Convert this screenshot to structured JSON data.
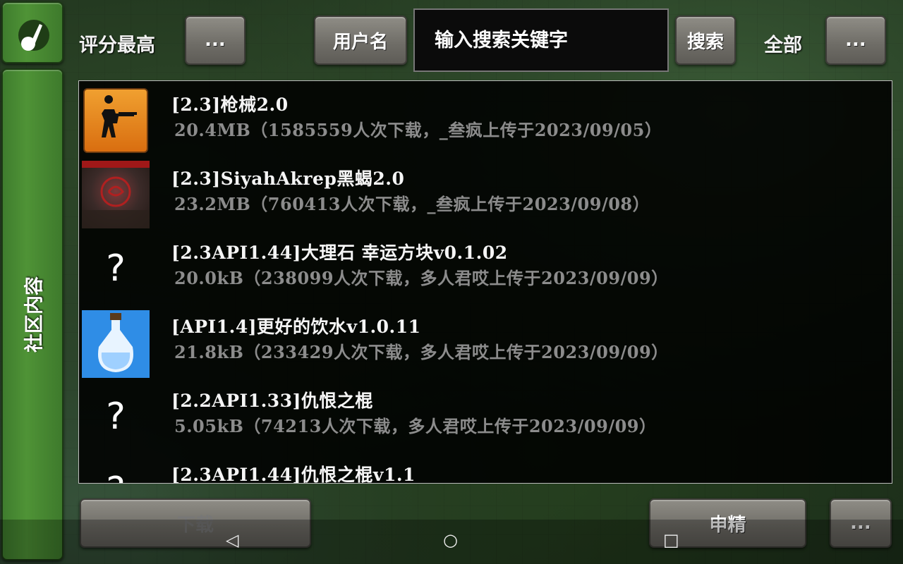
{
  "toolbar": {
    "sort_label": "评分最高",
    "sort_more": "...",
    "username_button": "用户名",
    "search_placeholder": "输入搜索关键字",
    "search_button": "搜索",
    "filter_label": "全部",
    "filter_more": "..."
  },
  "sidebar": {
    "community_tab": "社区内容"
  },
  "items": [
    {
      "title": "[2.3]枪械2.0",
      "meta": "20.4MB（1585559人次下载，_叁疯上传于2023/09/05）",
      "icon": "soldier-rifle-icon"
    },
    {
      "title": "[2.3]SiyahAkrep黑蝎2.0",
      "meta": "23.2MB（760413人次下载，_叁疯上传于2023/09/08）",
      "icon": "scorpion-emblem-icon"
    },
    {
      "title": "[2.3API1.44]大理石 幸运方块v0.1.02",
      "meta": "20.0kB（238099人次下载，多人君哎上传于2023/09/09）",
      "icon": "question-mark-icon"
    },
    {
      "title": "[API1.4]更好的饮水v1.0.11",
      "meta": "21.8kB（233429人次下载，多人君哎上传于2023/09/09）",
      "icon": "water-bottle-icon"
    },
    {
      "title": "[2.2API1.33]仇恨之棍",
      "meta": "5.05kB（74213人次下载，多人君哎上传于2023/09/09）",
      "icon": "question-mark-icon"
    },
    {
      "title": "[2.3API1.44]仇恨之棍v1.1",
      "meta": "",
      "icon": "question-mark-icon"
    }
  ],
  "placeholder_glyph": "?",
  "bottom": {
    "download_button": "下载",
    "apply_featured_button": "申精",
    "more_button": "..."
  },
  "nav": {
    "back": "◁",
    "home": "○",
    "recent": "□"
  }
}
